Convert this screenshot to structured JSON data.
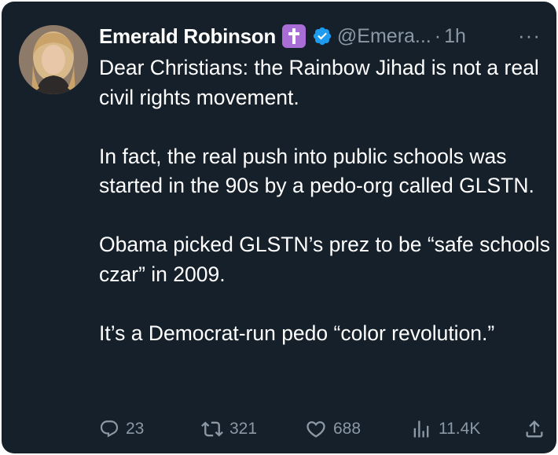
{
  "tweet": {
    "author": {
      "name": "Emerald Robinson",
      "handle": "@Emera...",
      "badge_emoji": "cross-emoji",
      "verified": true
    },
    "separator": "·",
    "time": "1h",
    "more_label": "···",
    "paragraphs": [
      "Dear Christians: the Rainbow Jihad is not a real civil rights movement.",
      "In fact, the real push into public schools was started in the 90s by a pedo-org called GLSTN.",
      "Obama picked GLSTN’s prez to be “safe schools czar” in 2009.",
      "It’s a Democrat-run pedo “color revolution.”"
    ],
    "actions": {
      "replies": "23",
      "retweets": "321",
      "likes": "688",
      "views": "11.4K"
    }
  },
  "colors": {
    "background": "#15202b",
    "text": "#ffffff",
    "muted": "#8b98a5",
    "verified": "#1d9bf0",
    "emoji_bg": "#a96ed6"
  }
}
